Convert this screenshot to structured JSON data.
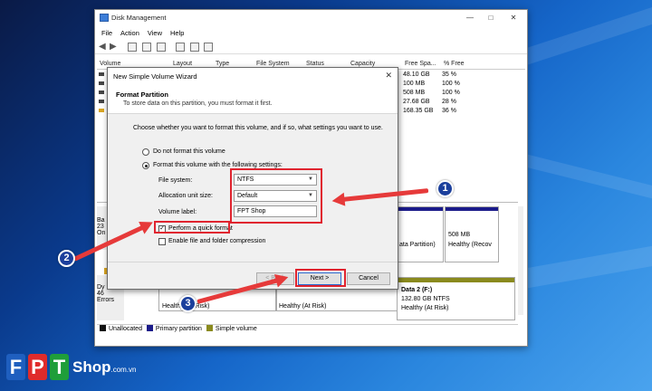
{
  "dm": {
    "title": "Disk Management",
    "menu": [
      "File",
      "Action",
      "View",
      "Help"
    ],
    "columns": [
      "Volume",
      "Layout",
      "Type",
      "File System",
      "Status",
      "Capacity",
      "Free Spa...",
      "% Free"
    ],
    "rows": [
      {
        "free": "48.10 GB",
        "pct": "35 %"
      },
      {
        "free": "100 MB",
        "pct": "100 %"
      },
      {
        "free": "508 MB",
        "pct": "100 %"
      },
      {
        "free": "27.68 GB",
        "pct": "28 %"
      },
      {
        "free": "168.35 GB",
        "pct": "36 %"
      }
    ],
    "disk0_left": [
      "Ba",
      "23",
      "On"
    ],
    "disk1_left": [
      "Dy",
      "46",
      "Errors"
    ],
    "partitions": {
      "data_partition": "ata Partition)",
      "recov_size": "508 MB",
      "recov_status": "Healthy (Recov",
      "at_risk_1": "Healthy (At Risk)",
      "at_risk_2": "Healthy (At Risk)",
      "data2_name": "Data 2  (F:)",
      "data2_size": "132.80 GB NTFS",
      "data2_status": "Healthy (At Risk)"
    },
    "legend": [
      "Unallocated",
      "Primary partition",
      "Simple volume"
    ]
  },
  "wizard": {
    "title": "New Simple Volume Wizard",
    "heading": "Format Partition",
    "subheading": "To store data on this partition, you must format it first.",
    "instruction": "Choose whether you want to format this volume, and if so, what settings you want to use.",
    "opt_no_format": "Do not format this volume",
    "opt_format": "Format this volume with the following settings:",
    "fs_label": "File system:",
    "fs_value": "NTFS",
    "alloc_label": "Allocation unit size:",
    "alloc_value": "Default",
    "vol_label": "Volume label:",
    "vol_value": "FPT Shop",
    "quick_format": "Perform a quick format",
    "compression": "Enable file and folder compression",
    "back_btn": "< Back",
    "next_btn": "Next >",
    "cancel_btn": "Cancel"
  },
  "callouts": [
    "1",
    "2",
    "3"
  ],
  "brand": {
    "letters": [
      "F",
      "P",
      "T"
    ],
    "shop": "Shop",
    "domain": ".com.vn",
    "colors": {
      "f": "#1f5fbf",
      "p": "#e02b2b",
      "t": "#1f9e3a",
      "highlight": "#e0242f",
      "callout": "#1b3f9c"
    }
  }
}
